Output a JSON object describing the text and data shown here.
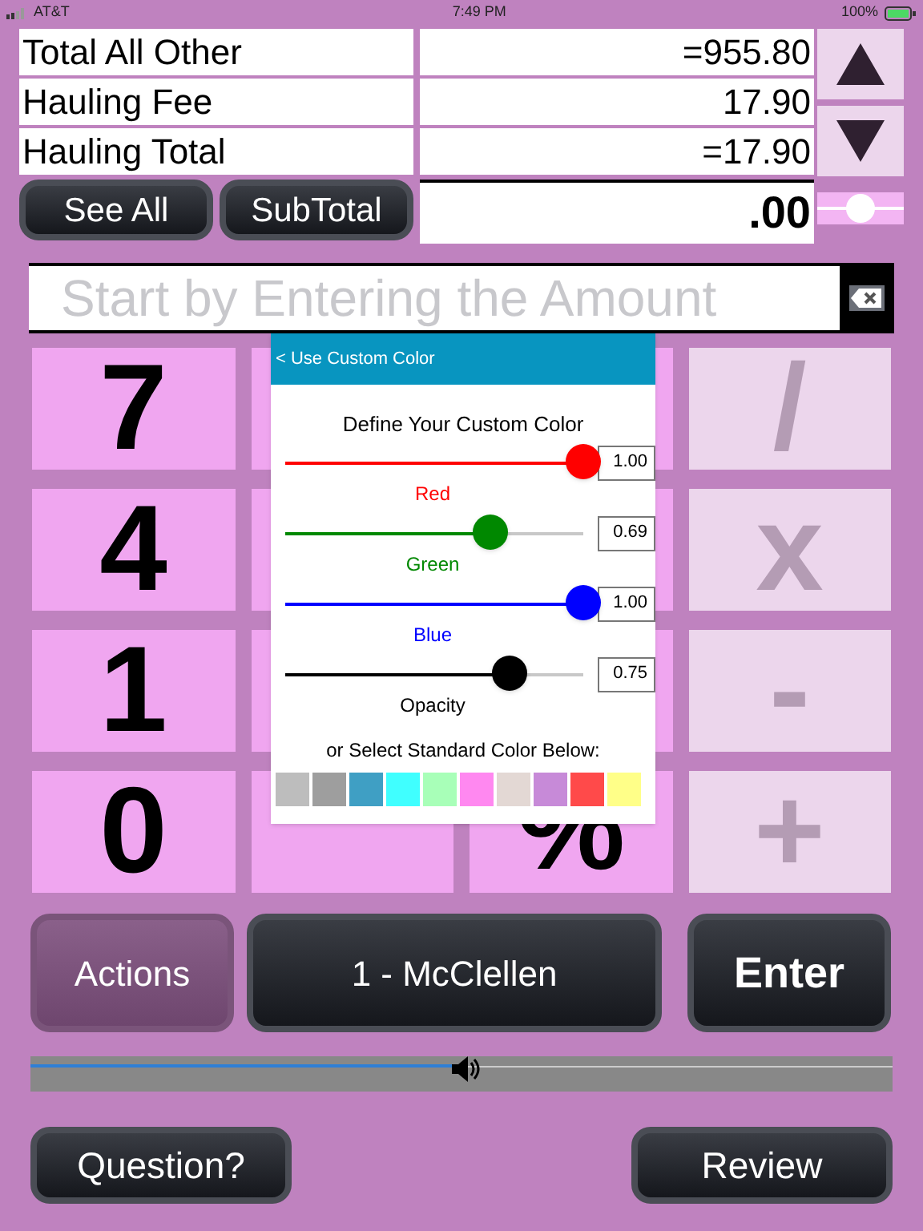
{
  "status_bar": {
    "carrier": "AT&T",
    "time": "7:49 PM",
    "battery": "100%"
  },
  "summary_rows": [
    {
      "label": "Total All Other",
      "value": "=955.80"
    },
    {
      "label": "Hauling Fee",
      "value": "17.90"
    },
    {
      "label": "Hauling Total",
      "value": "=17.90"
    }
  ],
  "buttons_row": [
    "See All",
    "SubTotal"
  ],
  "total": ".00",
  "size_slider": {
    "level": 0.5
  },
  "amount_field": {
    "placeholder": "Start by Entering the Amount"
  },
  "keys": [
    {
      "kind": "digit",
      "label": "7"
    },
    {
      "kind": "digit"
    },
    {
      "kind": "digit"
    },
    {
      "kind": "operator",
      "label": "/"
    },
    {
      "kind": "digit",
      "label": "4"
    },
    {
      "kind": "digit"
    },
    {
      "kind": "digit"
    },
    {
      "kind": "operator",
      "label": "x"
    },
    {
      "kind": "digit",
      "label": "1"
    },
    {
      "kind": "digit"
    },
    {
      "kind": "digit"
    },
    {
      "kind": "operator",
      "label": "-"
    },
    {
      "kind": "digit",
      "label": "0"
    },
    {
      "kind": "digit"
    },
    {
      "kind": "digit",
      "label": "%"
    },
    {
      "kind": "operator",
      "label": "+"
    }
  ],
  "color_popup": {
    "back": "< Use Custom Color",
    "heading": "Define Your Custom Color",
    "sliders": [
      {
        "name": "Red",
        "color": "#ff0000",
        "level": 1.0,
        "reading": "1.00"
      },
      {
        "name": "Green",
        "color": "#008800",
        "level": 0.69,
        "reading": "0.69"
      },
      {
        "name": "Blue",
        "color": "#0000ff",
        "level": 1.0,
        "reading": "1.00"
      },
      {
        "name": "Opacity",
        "color": "#000000",
        "level": 0.75,
        "reading": "0.75"
      }
    ],
    "standard_label": "or Select Standard Color Below:",
    "swatches": [
      {
        "color": "#bdbdbd"
      },
      {
        "color": "#9e9e9e"
      },
      {
        "color": "#3f9fc4"
      },
      {
        "color": "#40ffff"
      },
      {
        "color": "#a8ffb8"
      },
      {
        "color": "#ff88f0"
      },
      {
        "color": "#e3d8d4"
      },
      {
        "color": "#c78ad8"
      },
      {
        "color": "#ff4a4a"
      },
      {
        "color": "#ffff88"
      }
    ]
  },
  "actions": {
    "left": "Actions",
    "customer": "1 - McClellen",
    "enter": "Enter"
  },
  "volume": {
    "level": 0.49
  },
  "bottom_buttons": [
    "Question?",
    "Review"
  ]
}
